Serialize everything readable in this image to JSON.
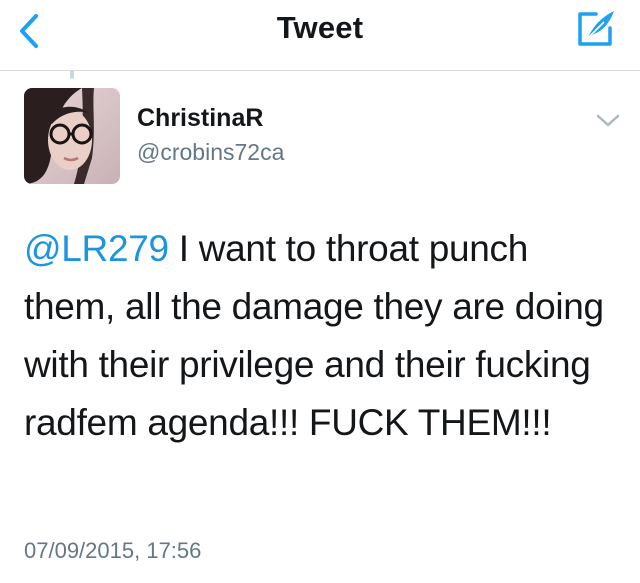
{
  "navbar": {
    "title": "Tweet",
    "back_icon": "back-chevron-icon",
    "compose_icon": "compose-tweet-icon"
  },
  "tweet": {
    "author": {
      "name": "ChristinaR",
      "handle": "@crobins72ca"
    },
    "mention": "@LR279",
    "text": " I want to throat punch them, all the damage they are doing with their privilege and their fucking radfem agenda!!! FUCK THEM!!!",
    "timestamp": "07/09/2015, 17:56",
    "caret_icon": "chevron-down-icon"
  },
  "colors": {
    "accent": "#1b95e0",
    "secondary_text": "#657786",
    "divider": "#d8dadc"
  }
}
